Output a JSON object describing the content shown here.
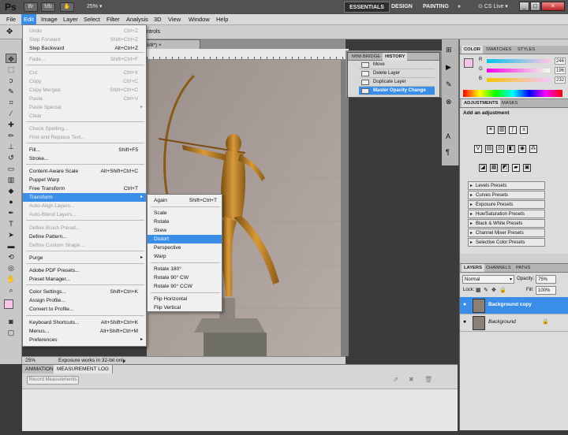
{
  "app": {
    "logo": "Ps",
    "zoom": "25%"
  },
  "workspaces": {
    "essentials": "ESSENTIALS",
    "design": "DESIGN",
    "painting": "PAINTING",
    "more": "»",
    "cs_live": "CS Live"
  },
  "window_buttons": {
    "min": "_",
    "max": "□",
    "close": "×"
  },
  "menubar": [
    "File",
    "Edit",
    "Image",
    "Layer",
    "Select",
    "Filter",
    "Analysis",
    "3D",
    "View",
    "Window",
    "Help"
  ],
  "options": {
    "controls": "ntrols"
  },
  "doc_tab": "RGB/8*)",
  "status": {
    "zoom": "25%",
    "msg": "Exposure works in 32-bit only"
  },
  "edit_menu": [
    {
      "label": "Undo",
      "shortcut": "Ctrl+Z",
      "disabled": true
    },
    {
      "label": "Step Forward",
      "shortcut": "Shift+Ctrl+Z",
      "disabled": true
    },
    {
      "label": "Step Backward",
      "shortcut": "Alt+Ctrl+Z",
      "disabled": false
    },
    {
      "label": "Fade...",
      "shortcut": "Shift+Ctrl+F",
      "disabled": true
    },
    {
      "label": "Cut",
      "shortcut": "Ctrl+X",
      "disabled": true
    },
    {
      "label": "Copy",
      "shortcut": "Ctrl+C",
      "disabled": true
    },
    {
      "label": "Copy Merged",
      "shortcut": "Shift+Ctrl+C",
      "disabled": true
    },
    {
      "label": "Paste",
      "shortcut": "Ctrl+V",
      "disabled": true
    },
    {
      "label": "Paste Special",
      "shortcut": "",
      "disabled": true,
      "submenu": true
    },
    {
      "label": "Clear",
      "shortcut": "",
      "disabled": true
    },
    {
      "label": "Check Spelling...",
      "shortcut": "",
      "disabled": true
    },
    {
      "label": "Find and Replace Text...",
      "shortcut": "",
      "disabled": true
    },
    {
      "label": "Fill...",
      "shortcut": "Shift+F5",
      "disabled": false
    },
    {
      "label": "Stroke...",
      "shortcut": "",
      "disabled": false
    },
    {
      "label": "Content-Aware Scale",
      "shortcut": "Alt+Shift+Ctrl+C",
      "disabled": false
    },
    {
      "label": "Puppet Warp",
      "shortcut": "",
      "disabled": false
    },
    {
      "label": "Free Transform",
      "shortcut": "Ctrl+T",
      "disabled": false
    },
    {
      "label": "Transform",
      "shortcut": "",
      "disabled": false,
      "submenu": true,
      "highlighted": true
    },
    {
      "label": "Auto-Align Layers...",
      "shortcut": "",
      "disabled": true
    },
    {
      "label": "Auto-Blend Layers...",
      "shortcut": "",
      "disabled": true
    },
    {
      "label": "Define Brush Preset...",
      "shortcut": "",
      "disabled": true
    },
    {
      "label": "Define Pattern...",
      "shortcut": "",
      "disabled": false
    },
    {
      "label": "Define Custom Shape...",
      "shortcut": "",
      "disabled": true
    },
    {
      "label": "Purge",
      "shortcut": "",
      "disabled": false,
      "submenu": true
    },
    {
      "label": "Adobe PDF Presets...",
      "shortcut": "",
      "disabled": false
    },
    {
      "label": "Preset Manager...",
      "shortcut": "",
      "disabled": false
    },
    {
      "label": "Color Settings...",
      "shortcut": "Shift+Ctrl+K",
      "disabled": false
    },
    {
      "label": "Assign Profile...",
      "shortcut": "",
      "disabled": false
    },
    {
      "label": "Convert to Profile...",
      "shortcut": "",
      "disabled": false
    },
    {
      "label": "Keyboard Shortcuts...",
      "shortcut": "Alt+Shift+Ctrl+K",
      "disabled": false
    },
    {
      "label": "Menus...",
      "shortcut": "Alt+Shift+Ctrl+M",
      "disabled": false
    },
    {
      "label": "Preferences",
      "shortcut": "",
      "disabled": false,
      "submenu": true
    }
  ],
  "transform_menu": [
    {
      "label": "Again",
      "shortcut": "Shift+Ctrl+T"
    },
    {
      "label": "Scale",
      "shortcut": ""
    },
    {
      "label": "Rotate",
      "shortcut": ""
    },
    {
      "label": "Skew",
      "shortcut": ""
    },
    {
      "label": "Distort",
      "shortcut": "",
      "highlighted": true
    },
    {
      "label": "Perspective",
      "shortcut": ""
    },
    {
      "label": "Warp",
      "shortcut": ""
    },
    {
      "label": "Rotate 180°",
      "shortcut": ""
    },
    {
      "label": "Rotate 90° CW",
      "shortcut": ""
    },
    {
      "label": "Rotate 90° CCW",
      "shortcut": ""
    },
    {
      "label": "Flip Horizontal",
      "shortcut": ""
    },
    {
      "label": "Flip Vertical",
      "shortcut": ""
    }
  ],
  "history": {
    "tabs": [
      "MINI BRIDGE",
      "HISTORY"
    ],
    "items": [
      "Move",
      "Delete Layer",
      "Duplicate Layer",
      "Master Opacity Change"
    ],
    "selected_index": 3
  },
  "color_panel": {
    "tabs": [
      "COLOR",
      "SWATCHES",
      "STYLES"
    ],
    "channels": [
      {
        "name": "R",
        "value": "246"
      },
      {
        "name": "G",
        "value": "196"
      },
      {
        "name": "B",
        "value": "232"
      }
    ],
    "foreground": "#f6c4e8"
  },
  "adjustments": {
    "tabs": [
      "ADJUSTMENTS",
      "MASKS"
    ],
    "heading": "Add an adjustment",
    "presets": [
      "Levels Presets",
      "Curves Presets",
      "Exposure Presets",
      "Hue/Saturation Presets",
      "Black & White Presets",
      "Channel Mixer Presets",
      "Selective Color Presets"
    ]
  },
  "layers_panel": {
    "tabs": [
      "LAYERS",
      "CHANNELS",
      "PATHS"
    ],
    "blend_mode": "Normal",
    "opacity_label": "Opacity:",
    "opacity": "75%",
    "lock_label": "Lock:",
    "fill_label": "Fill:",
    "fill": "100%",
    "layers": [
      {
        "name": "Background copy",
        "selected": true
      },
      {
        "name": "Background",
        "selected": false
      }
    ]
  },
  "bottom_panel": {
    "tabs": [
      "ANIMATION",
      "MEASUREMENT LOG"
    ],
    "record_button": "Record Measurements"
  },
  "colors": {
    "highlight": "#3b8ee8",
    "foreground": "#f6c4e8"
  }
}
